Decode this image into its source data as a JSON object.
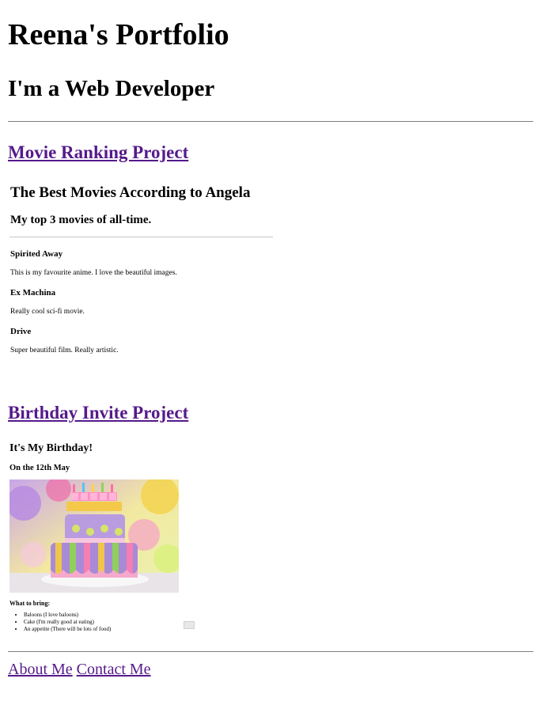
{
  "header": {
    "title": "Reena's Portfolio",
    "subtitle": "I'm a Web Developer"
  },
  "projects": [
    {
      "link_text": "Movie Ranking Project",
      "preview": {
        "title": "The Best Movies According to Angela",
        "subtitle": "My top 3 movies of all-time.",
        "movies": [
          {
            "name": "Spirited Away",
            "description": "This is my favourite anime. I love the beautiful images."
          },
          {
            "name": "Ex Machina",
            "description": "Really cool sci-fi movie."
          },
          {
            "name": "Drive",
            "description": "Super beautiful film. Really artistic."
          }
        ]
      }
    },
    {
      "link_text": "Birthday Invite Project",
      "preview": {
        "title": "It's My Birthday!",
        "date": "On the 12th May",
        "image_icon": "birthday-cake-image",
        "bring_heading": "What to bring:",
        "bring_items": [
          "Baloons (I love baloons)",
          "Cake (I'm really good at eating)",
          "An appetite (There will be lots of food)"
        ]
      }
    }
  ],
  "footer": {
    "about_label": "About Me",
    "contact_label": "Contact Me"
  },
  "colors": {
    "link": "#551a8b",
    "divider": "#808080"
  }
}
